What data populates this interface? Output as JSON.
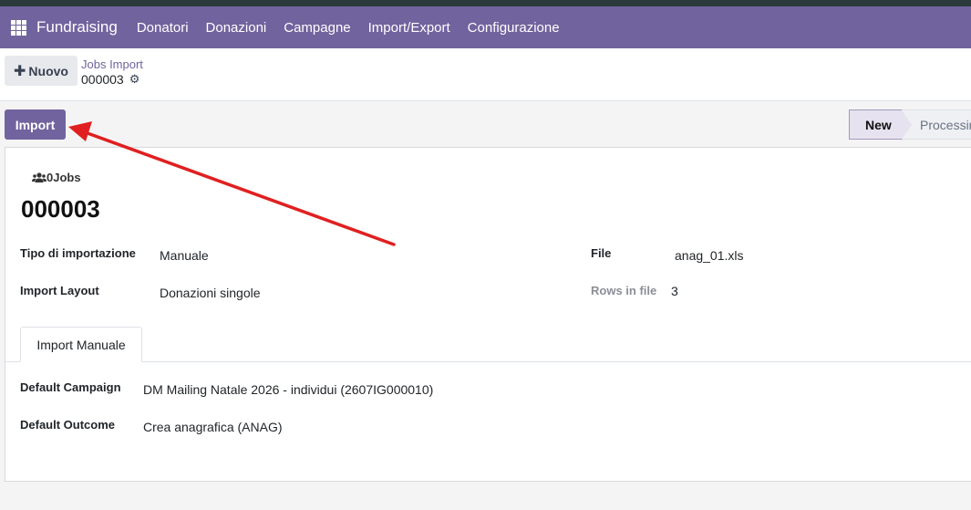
{
  "navbar": {
    "app_name": "Fundraising",
    "menu": [
      {
        "label": "Donatori"
      },
      {
        "label": "Donazioni"
      },
      {
        "label": "Campagne"
      },
      {
        "label": "Import/Export"
      },
      {
        "label": "Configurazione"
      }
    ],
    "apps_icon": "apps-grid-icon"
  },
  "control_panel": {
    "new_label": "Nuovo",
    "breadcrumb": "Jobs Import",
    "record_id": "000003",
    "gear_icon": "gear-icon"
  },
  "statusbar": {
    "import_label": "Import",
    "stages": [
      {
        "label": "New",
        "active": true
      },
      {
        "label": "Processing",
        "active": false
      }
    ]
  },
  "form": {
    "smart_button": "0Jobs",
    "title": "000003",
    "fields_left": [
      {
        "label": "Tipo di importazione",
        "value": "Manuale"
      },
      {
        "label": "Import Layout",
        "value": "Donazioni singole"
      }
    ],
    "fields_right": [
      {
        "label": "File",
        "value": "anag_01.xls"
      },
      {
        "label": "Rows in file",
        "value": "3"
      }
    ],
    "tab": "Import Manuale",
    "tab_fields": [
      {
        "label": "Default Campaign",
        "value": "DM Mailing Natale 2026 -  individui (2607IG000010)"
      },
      {
        "label": "Default Outcome",
        "value": "Crea anagrafica (ANAG)"
      }
    ]
  },
  "colors": {
    "brand": "#71639e",
    "annotation_arrow": "#e02020"
  }
}
